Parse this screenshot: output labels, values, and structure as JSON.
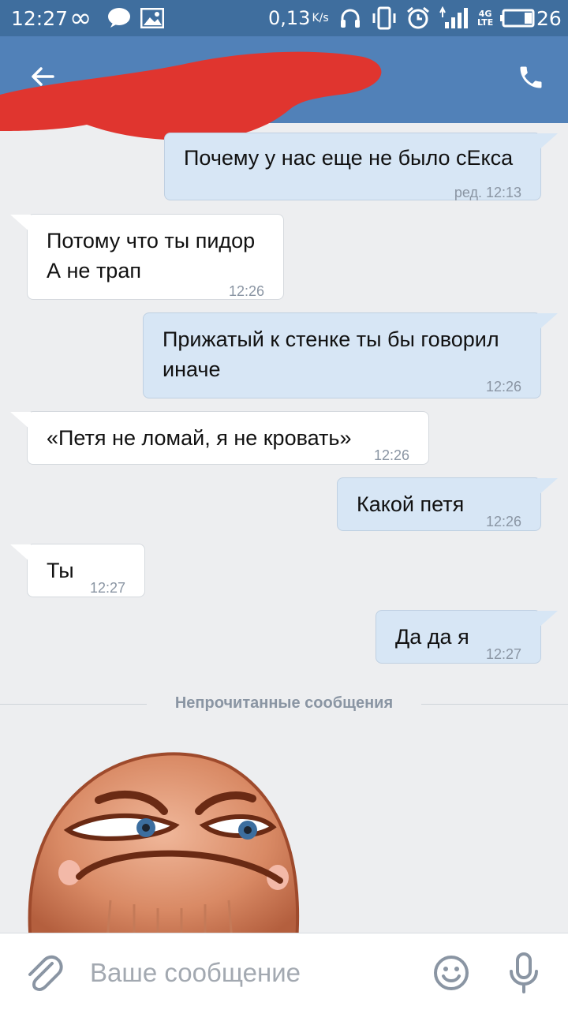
{
  "status_bar": {
    "time": "12:27",
    "net_speed": "0,13",
    "net_speed_unit": "K/s",
    "network_type_top": "4G",
    "network_type_bottom": "LTE",
    "battery_level": "26"
  },
  "colors": {
    "status_bar": "#3f6e9e",
    "app_bar": "#5181b8",
    "outgoing_bubble": "#d7e6f5",
    "incoming_bubble": "#ffffff",
    "chat_background": "#edeef0",
    "redaction": "#e0352f"
  },
  "icons": {
    "back": "arrow-left-icon",
    "call": "phone-icon",
    "attach": "paperclip-icon",
    "emoji": "smiley-icon",
    "mic": "microphone-icon"
  },
  "messages": [
    {
      "direction": "out",
      "text": "Почему у нас еще не было сЕкса",
      "time": "ред. 12:13"
    },
    {
      "direction": "in",
      "text": "Потому что ты пидор\nА не трап",
      "time": "12:26"
    },
    {
      "direction": "out",
      "text": "Прижатый к стенке ты бы говорил\nиначе",
      "time": "12:26"
    },
    {
      "direction": "in",
      "text": "«Петя не ломай, я не кровать»",
      "time": "12:26"
    },
    {
      "direction": "out",
      "text": "Какой петя",
      "time": "12:26"
    },
    {
      "direction": "in",
      "text": "Ты",
      "time": "12:27"
    },
    {
      "direction": "out",
      "text": "Да да я",
      "time": "12:27"
    }
  ],
  "unread_divider": "Непрочитанные сообщения",
  "input": {
    "placeholder": "Ваше сообщение",
    "value": ""
  }
}
